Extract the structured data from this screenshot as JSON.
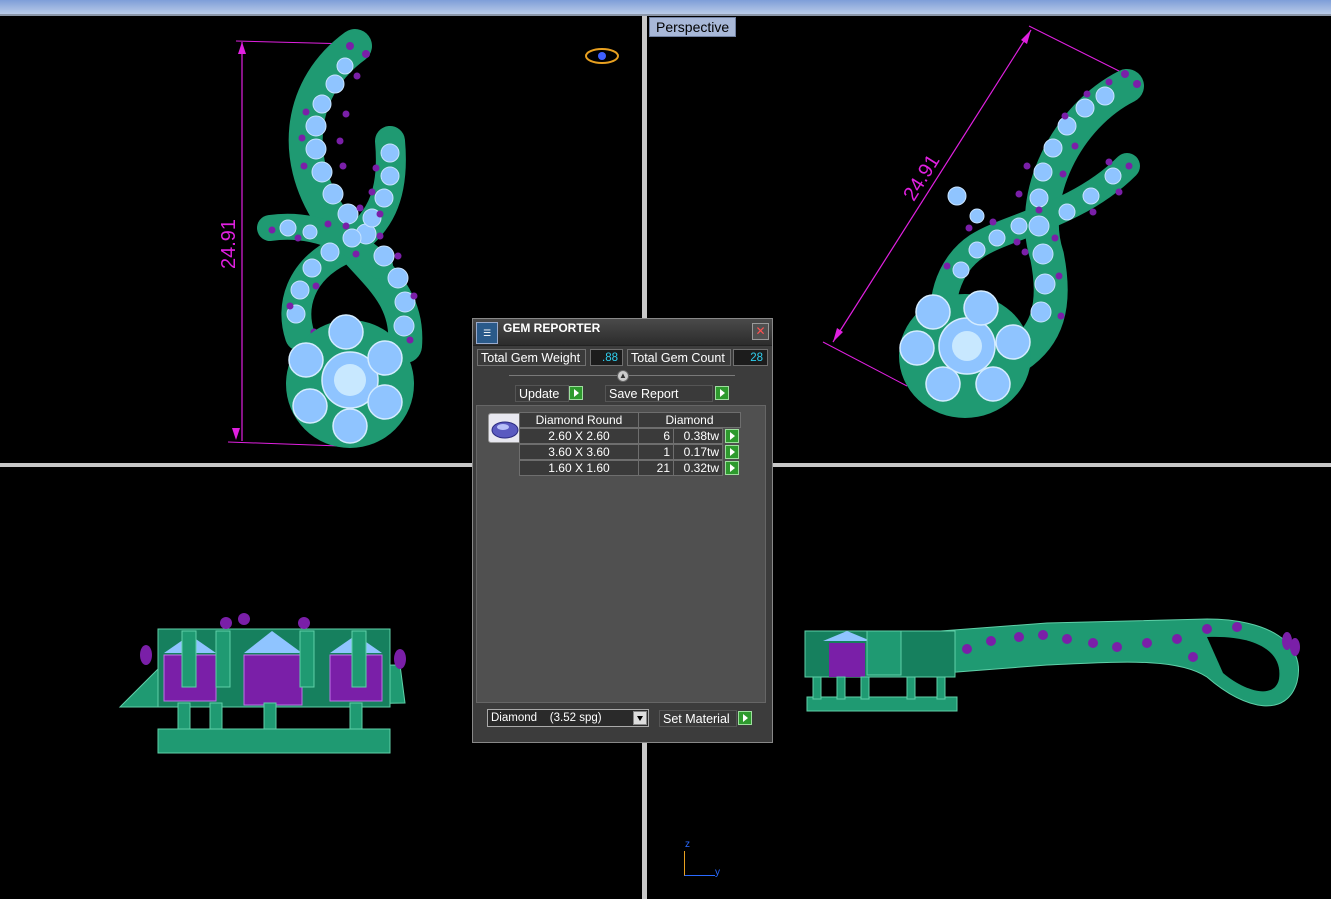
{
  "viewports": {
    "perspective_label": "Perspective",
    "front_dimension": "24.91",
    "perspective_dimension": "24.91"
  },
  "axis": {
    "z": "z",
    "y": "y"
  },
  "gem_reporter": {
    "title": "GEM REPORTER",
    "icon_name": "gem-reporter-icon",
    "total_gem_weight_label": "Total Gem Weight",
    "total_gem_weight_value": ".88",
    "total_gem_count_label": "Total Gem Count",
    "total_gem_count_value": "28",
    "update_label": "Update",
    "save_report_label": "Save Report",
    "table": {
      "headers": [
        "Diamond Round",
        "Diamond"
      ],
      "rows": [
        {
          "size": "2.60 X 2.60",
          "count": "6",
          "weight": "0.38tw"
        },
        {
          "size": "3.60 X 3.60",
          "count": "1",
          "weight": "0.17tw"
        },
        {
          "size": "1.60 X 1.60",
          "count": "21",
          "weight": "0.32tw"
        }
      ]
    },
    "material_select": {
      "selected": "Diamond    (3.52 spg)"
    },
    "set_material_label": "Set Material"
  },
  "colors": {
    "metal": "#1f9a72",
    "gem": "#8fc4ff",
    "prong": "#7a1fa8",
    "dimension": "#e020e0",
    "panel_bg": "#3c3c3c",
    "value_text": "#2fd0f0"
  }
}
